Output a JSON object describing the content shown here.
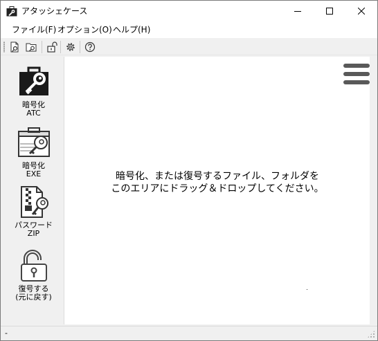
{
  "window": {
    "title": "アタッシェケース"
  },
  "menu": {
    "file": "ファイル(F)",
    "options": "オプション(O)",
    "help": "ヘルプ(H)"
  },
  "toolbar": {
    "icons": [
      "encrypt-file-icon",
      "decrypt-folder-icon",
      "lock-icon",
      "settings-gear-icon",
      "help-icon"
    ]
  },
  "sidebar": {
    "items": [
      {
        "label": "暗号化\nATC",
        "icon": "briefcase-key-icon"
      },
      {
        "label": "暗号化\nEXE",
        "icon": "box-key-icon"
      },
      {
        "label": "パスワード\nZIP",
        "icon": "zip-key-icon"
      },
      {
        "label": "復号する\n(元に戻す)",
        "icon": "padlock-open-icon"
      }
    ]
  },
  "droparea": {
    "message": "暗号化、または復号するファイル、フォルダを\nこのエリアにドラッグ＆ドロップしてください。"
  },
  "statusbar": {
    "text": "-"
  }
}
